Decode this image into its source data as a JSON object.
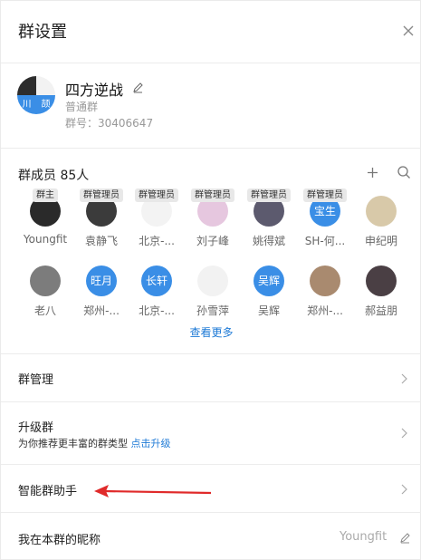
{
  "header": {
    "title": "群设置"
  },
  "group": {
    "name": "四方逆战",
    "type": "普通群",
    "id_text": "群号：30406647",
    "avatar_chars": [
      "川",
      "颉"
    ]
  },
  "members": {
    "title": "群成员 85人",
    "see_more": "查看更多",
    "items": [
      {
        "name": "Youngfit",
        "role": "群主"
      },
      {
        "name": "袁静飞",
        "role": "群管理员"
      },
      {
        "name": "北京-...",
        "role": "群管理员"
      },
      {
        "name": "刘子峰",
        "role": "群管理员"
      },
      {
        "name": "姚得斌",
        "role": "群管理员"
      },
      {
        "name": "SH-何...",
        "role": "群管理员",
        "avatar_text": "宝生"
      },
      {
        "name": "申纪明"
      },
      {
        "name": "老八"
      },
      {
        "name": "郑州-...",
        "avatar_text": "旺月"
      },
      {
        "name": "北京-...",
        "avatar_text": "长轩"
      },
      {
        "name": "孙雪萍"
      },
      {
        "name": "吴辉",
        "avatar_text": "吴辉"
      },
      {
        "name": "郑州-..."
      },
      {
        "name": "郝益朋"
      }
    ]
  },
  "rows": {
    "manage": "群管理",
    "upgrade": {
      "label": "升级群",
      "sub": "为你推荐更丰富的群类型",
      "link": "点击升级"
    },
    "assistant": "智能群助手",
    "nickname": {
      "label": "我在本群的昵称",
      "value": "Youngfit"
    }
  },
  "colors": {
    "accent": "#1e7ad6",
    "avatar_blue": "#3a8ee6",
    "arrow": "#e02a2a"
  }
}
